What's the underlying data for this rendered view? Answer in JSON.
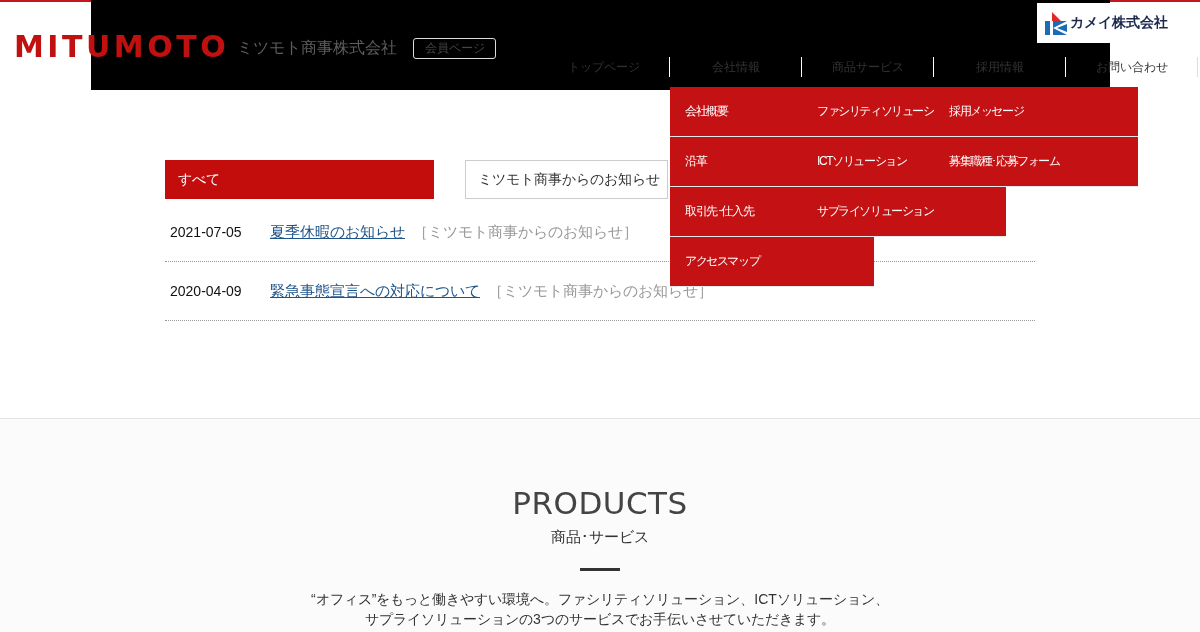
{
  "header": {
    "logo": "MITUMOTO",
    "company_name": "ミツモト商事株式会社",
    "member_button": "会員ページ",
    "partner_logo": "カメイ株式会社",
    "nav": [
      {
        "label": "トップページ"
      },
      {
        "label": "会社情報",
        "submenu": [
          "会社概要",
          "沿革",
          "取引先･仕入先",
          "アクセスマップ"
        ]
      },
      {
        "label": "商品サービス",
        "submenu": [
          "ファシリティソリューシ",
          "ICTソリューション",
          "サプライソリューション"
        ]
      },
      {
        "label": "採用情報",
        "submenu": [
          "採用メッセージ",
          "募集職種･応募フォーム"
        ]
      },
      {
        "label": "お問い合わせ"
      }
    ]
  },
  "news": {
    "tabs": [
      {
        "label": "すべて",
        "selected": true
      },
      {
        "label": "ミツモト商事からのお知らせ",
        "selected": false
      }
    ],
    "items": [
      {
        "date": "2021-07-05",
        "title": "夏季休暇のお知らせ",
        "category": "［ミツモト商事からのお知らせ］"
      },
      {
        "date": "2020-04-09",
        "title": "緊急事態宣言への対応について",
        "category": "［ミツモト商事からのお知らせ］"
      }
    ]
  },
  "products": {
    "heading": "PRODUCTS",
    "subheading": "商品･サービス",
    "description": "“オフィス”をもっと働きやすい環境へ。ファシリティソリューション、ICTソリューション、サプライソリューションの3つのサービスでお手伝いさせていただきます。"
  }
}
